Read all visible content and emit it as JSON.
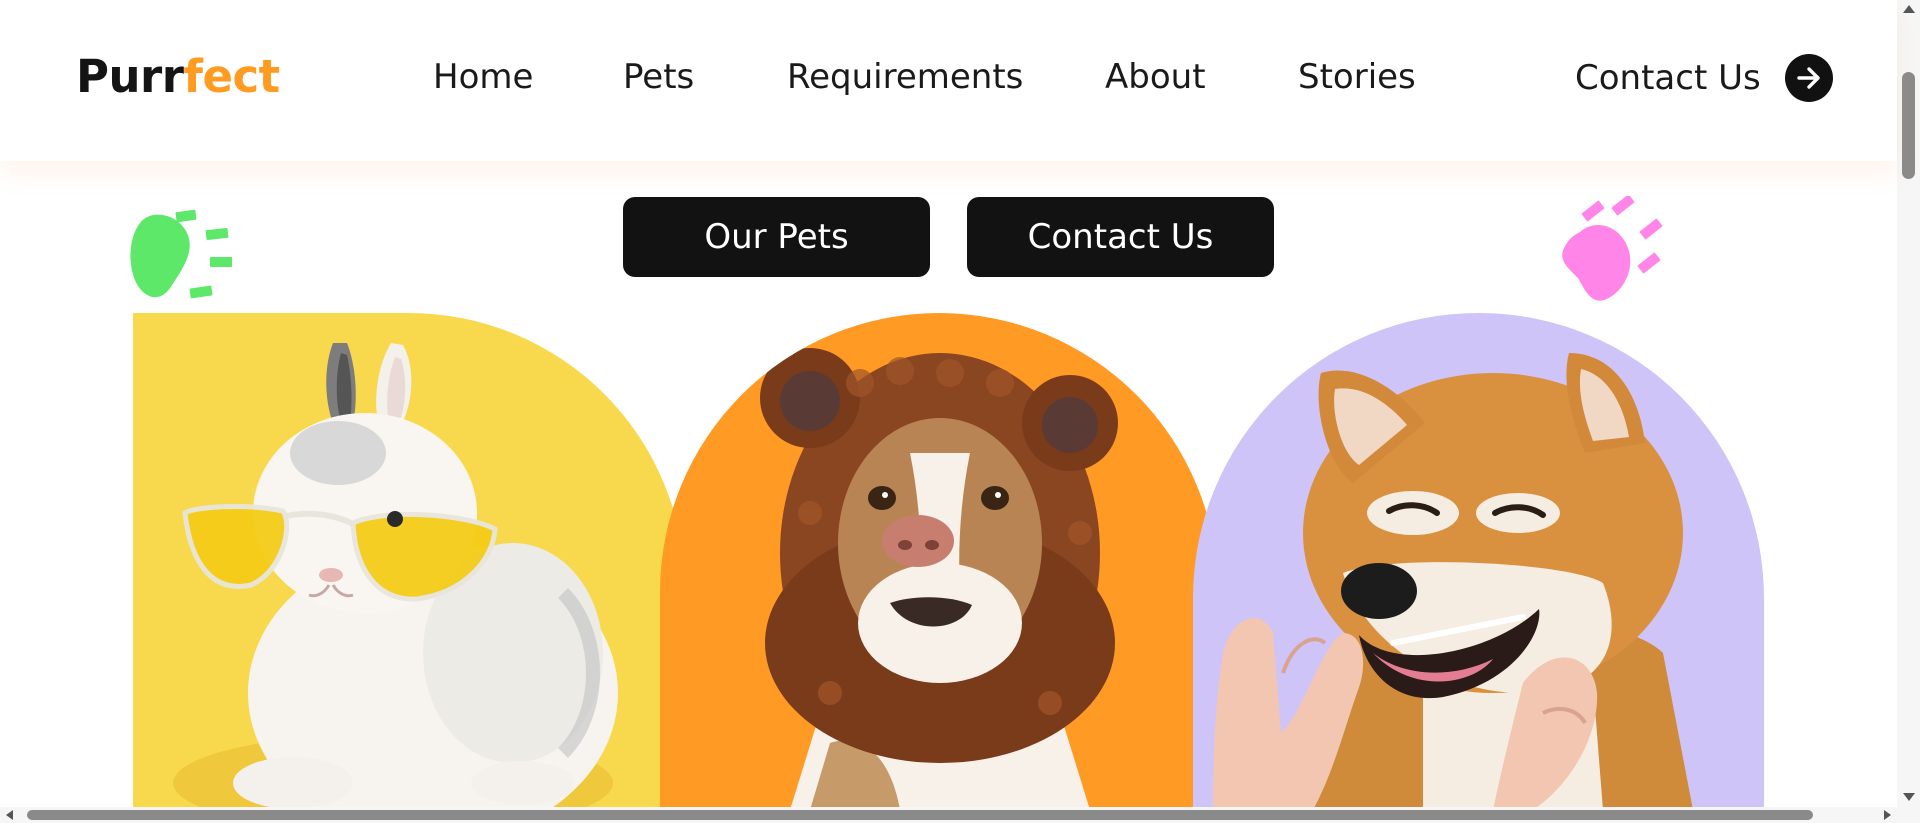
{
  "header": {
    "logo": {
      "part_a": "Purr",
      "part_b": "fect"
    },
    "nav": [
      {
        "label": "Home"
      },
      {
        "label": "Pets"
      },
      {
        "label": "Requirements"
      },
      {
        "label": "About"
      },
      {
        "label": "Stories"
      }
    ],
    "contact": {
      "label": "Contact Us",
      "icon": "arrow-right-icon"
    }
  },
  "hero": {
    "buttons": [
      {
        "label": "Our Pets"
      },
      {
        "label": "Contact Us"
      }
    ],
    "decorations": [
      {
        "icon": "paw-icon",
        "color": "#5ee86a"
      },
      {
        "icon": "paw-icon",
        "color": "#ff86e8"
      }
    ],
    "cards": [
      {
        "subject": "rabbit-with-yellow-sunglasses",
        "background": "#f8d94e"
      },
      {
        "subject": "dog-in-bear-hood",
        "background": "#ff9a24"
      },
      {
        "subject": "smiling-shiba-inu",
        "background": "#cec4f7"
      }
    ]
  },
  "colors": {
    "brand_accent": "#ff9b21",
    "button_bg": "#121212",
    "text": "#1a1a1a"
  }
}
